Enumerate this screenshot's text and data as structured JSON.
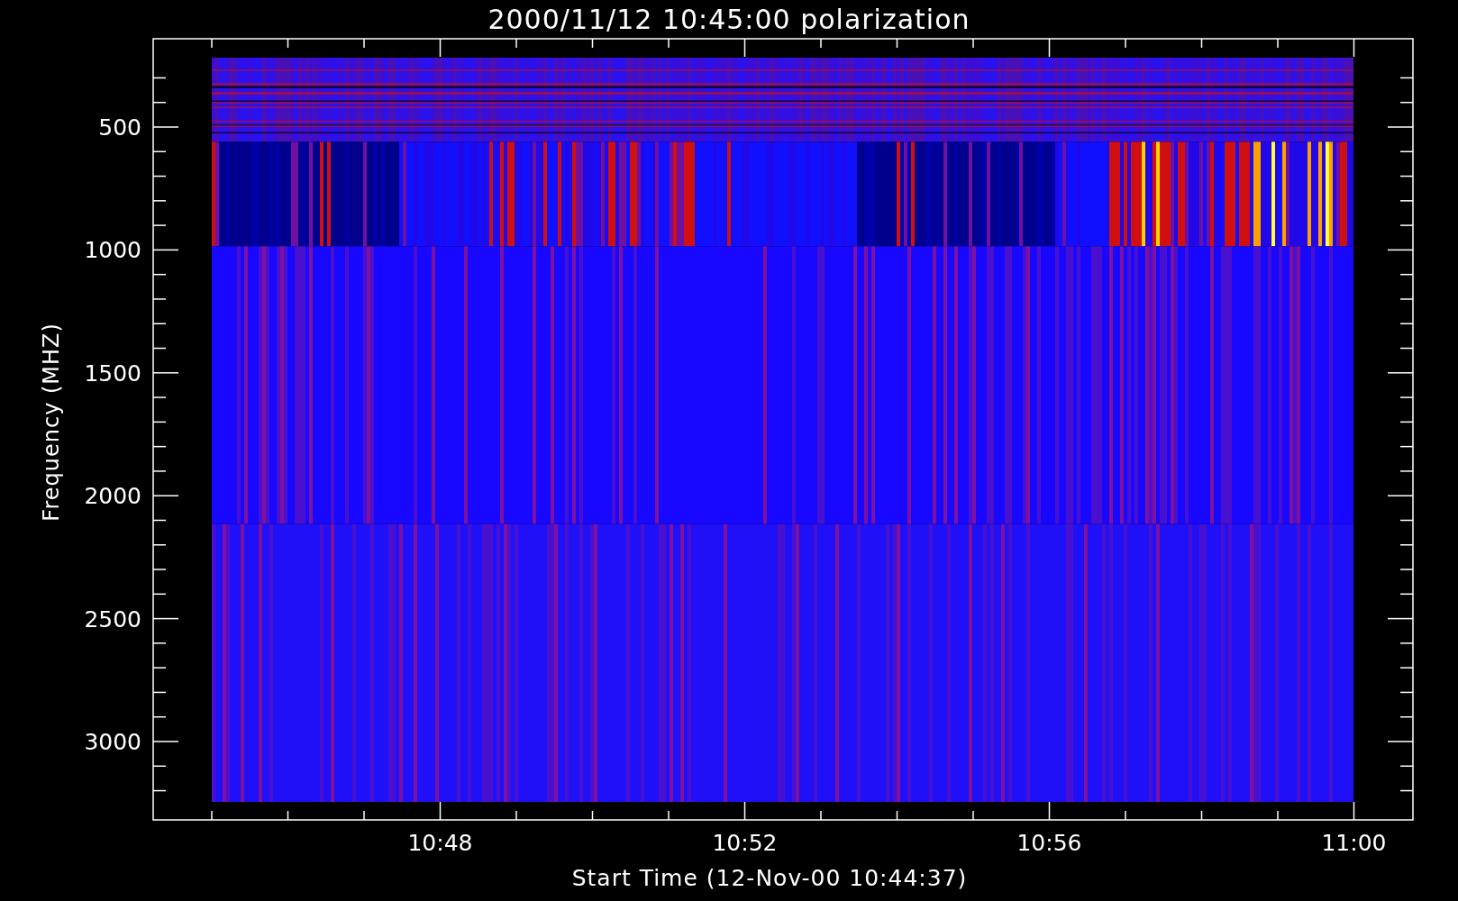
{
  "title": "2000/11/12 10:45:00 polarization",
  "y_axis": {
    "title": "Frequency (MHZ)",
    "tick_labels": [
      "500",
      "1000",
      "1500",
      "2000",
      "2500",
      "3000"
    ]
  },
  "x_axis": {
    "title": "Start Time (12-Nov-00 10:44:37)",
    "tick_labels": [
      "10:48",
      "10:52",
      "10:56",
      "11:00"
    ]
  }
}
